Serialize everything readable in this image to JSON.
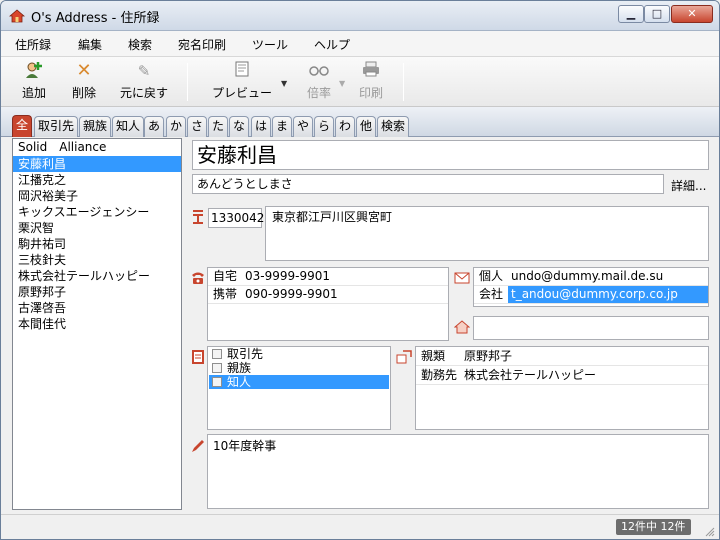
{
  "window": {
    "title": "O's Address - 住所録"
  },
  "menu": [
    "住所録",
    "編集",
    "検索",
    "宛名印刷",
    "ツール",
    "ヘルプ"
  ],
  "toolbar": {
    "add": "追加",
    "delete": "削除",
    "undo": "元に戻す",
    "preview": "プレビュー",
    "zoom": "倍率",
    "print": "印刷"
  },
  "tabs": [
    "全",
    "取引先",
    "親族",
    "知人",
    "あ",
    "か",
    "さ",
    "た",
    "な",
    "は",
    "ま",
    "や",
    "ら",
    "わ",
    "他",
    "検索"
  ],
  "contacts": [
    "Solid　Alliance",
    "安藤利昌",
    "江播克之",
    "岡沢裕美子",
    "キックスエージェンシー",
    "栗沢智",
    "駒井祐司",
    "三枝針夫",
    "株式会社テールハッピー",
    "原野邦子",
    "古澤啓吾",
    "本間佳代"
  ],
  "selected_index": 1,
  "detail": {
    "name": "安藤利昌",
    "kana": "あんどうとしまさ",
    "detail_link": "詳細...",
    "zip": "1330042",
    "address": "東京都江戸川区興宮町",
    "phones": [
      {
        "label": "自宅",
        "value": "03-9999-9901"
      },
      {
        "label": "携帯",
        "value": "090-9999-9901"
      }
    ],
    "emails": [
      {
        "label": "個人",
        "value": "undo@dummy.mail.de.su",
        "selected": false
      },
      {
        "label": "会社",
        "value": "t_andou@dummy.corp.co.jp",
        "selected": true
      }
    ],
    "categories": [
      {
        "label": "取引先",
        "checked": false,
        "selected": false
      },
      {
        "label": "親族",
        "checked": false,
        "selected": false
      },
      {
        "label": "知人",
        "checked": false,
        "selected": true
      }
    ],
    "relations": [
      {
        "label": "親類",
        "value": "原野邦子"
      },
      {
        "label": "勤務先",
        "value": "株式会社テールハッピー"
      }
    ],
    "memo": "10年度幹事"
  },
  "status": {
    "count": "12件中 12件"
  },
  "colors": {
    "accent_red": "#c8452e",
    "selection": "#3399ff"
  }
}
